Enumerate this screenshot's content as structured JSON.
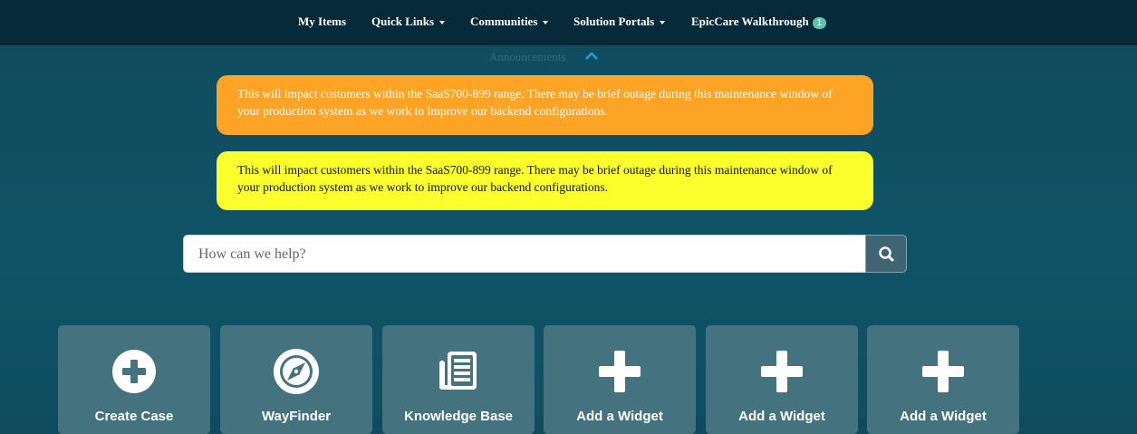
{
  "nav": {
    "my_items": "My Items",
    "quick_links": "Quick Links",
    "communities": "Communities",
    "solution_portals": "Solution Portals",
    "walkthrough": "EpicCare Walkthrough",
    "walkthrough_badge": "1"
  },
  "announcements": {
    "label": "Announcements",
    "alerts": [
      {
        "text": "This will impact customers within the SaaS700-899 range.  There may be brief outage during this maintenance window of your production system as we work to improve our backend configurations.",
        "color": "#fda426"
      },
      {
        "text": "This will impact customers within the SaaS700-899 range.  There may be brief outage during this maintenance window of your production system as we work to improve our backend configurations.",
        "color": "#fbff2c"
      }
    ]
  },
  "search": {
    "placeholder": "How can we help?",
    "icon": "search-icon"
  },
  "tiles": [
    {
      "label": "Create Case",
      "icon": "plus-circle-icon"
    },
    {
      "label": "WayFinder",
      "icon": "compass-icon"
    },
    {
      "label": "Knowledge Base",
      "icon": "newspaper-icon"
    },
    {
      "label": "Add a Widget",
      "icon": "plus-icon"
    },
    {
      "label": "Add a Widget",
      "icon": "plus-icon"
    },
    {
      "label": "Add a Widget",
      "icon": "plus-icon"
    }
  ],
  "colors": {
    "nav_bg": "#062a3a",
    "page_bg": "#105366",
    "tile_bg": "#44727f",
    "badge": "#5cc6a8",
    "accent": "#2a9fd6"
  }
}
